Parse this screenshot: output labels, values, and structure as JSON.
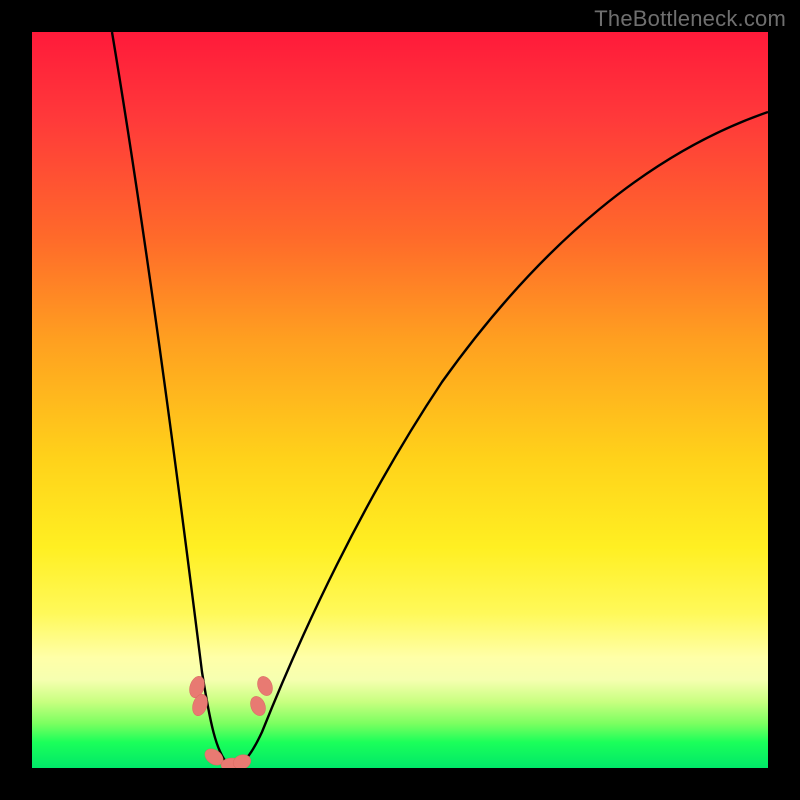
{
  "watermark": {
    "text": "TheBottleneck.com"
  },
  "chart_data": {
    "type": "line",
    "title": "",
    "xlabel": "",
    "ylabel": "",
    "xlim": [
      0,
      100
    ],
    "ylim": [
      0,
      100
    ],
    "series": [
      {
        "name": "bottleneck-curve",
        "x": [
          11,
          12,
          13,
          14,
          15,
          16,
          17,
          18,
          19,
          20,
          21,
          22,
          23,
          24,
          25,
          26,
          27,
          28,
          29,
          30,
          34,
          38,
          42,
          46,
          50,
          55,
          60,
          65,
          70,
          75,
          80,
          85,
          90,
          95,
          100
        ],
        "values": [
          100,
          92,
          84,
          76,
          68,
          60,
          52,
          44,
          36,
          28,
          21,
          15,
          9,
          5,
          2,
          0,
          0,
          1,
          4,
          8,
          16,
          24,
          31,
          38,
          44,
          51,
          57,
          62,
          67,
          71,
          74,
          77,
          79.5,
          81.5,
          83
        ]
      }
    ],
    "markers": [
      {
        "name": "marker-1",
        "x": 22.4,
        "y": 11.0
      },
      {
        "name": "marker-2",
        "x": 22.8,
        "y": 8.5
      },
      {
        "name": "marker-3",
        "x": 24.7,
        "y": 1.2
      },
      {
        "name": "marker-4",
        "x": 27.0,
        "y": 0.0
      },
      {
        "name": "marker-5",
        "x": 28.2,
        "y": 1.0
      },
      {
        "name": "marker-6",
        "x": 30.5,
        "y": 8.5
      },
      {
        "name": "marker-7",
        "x": 31.3,
        "y": 11.2
      }
    ],
    "gradient_stops": [
      {
        "pos": 0.0,
        "color": "#ff1a3a"
      },
      {
        "pos": 0.5,
        "color": "#ffd21a"
      },
      {
        "pos": 0.85,
        "color": "#ffffa8"
      },
      {
        "pos": 1.0,
        "color": "#00e868"
      }
    ]
  }
}
